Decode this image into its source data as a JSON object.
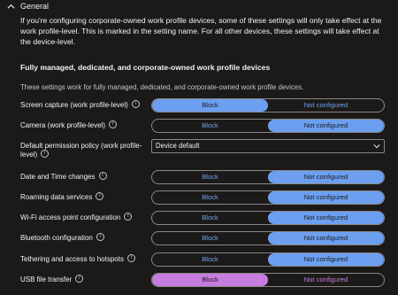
{
  "section": {
    "title": "General",
    "info": "If you're configuring corporate-owned work profile devices, some of these settings will only take effect at the work profile-level. This is marked in the setting name. For all other devices, these settings will take effect at the device-level.",
    "subheading": "Fully managed, dedicated, and corporate-owned work profile devices",
    "subdescription": "These settings work for fully managed, dedicated, and corporate-owned work profile devices."
  },
  "settings": [
    {
      "label": "Screen capture (work profile-level)",
      "type": "toggle",
      "left": "Block",
      "right": "Not configured",
      "selected": "Block",
      "accent": "#6c9ff0"
    },
    {
      "label": "Camera (work profile-level)",
      "type": "toggle",
      "left": "Block",
      "right": "Not configured",
      "selected": "Not configured",
      "accent": "#6c9ff0"
    },
    {
      "label": "Default permission policy (work profile-level)",
      "type": "dropdown",
      "value": "Device default"
    },
    {
      "label": "Date and Time changes",
      "type": "toggle",
      "left": "Block",
      "right": "Not configured",
      "selected": "Not configured",
      "accent": "#6c9ff0"
    },
    {
      "label": "Roaming data services",
      "type": "toggle",
      "left": "Block",
      "right": "Not configured",
      "selected": "Not configured",
      "accent": "#6c9ff0"
    },
    {
      "label": "Wi-Fi access point configuration",
      "type": "toggle",
      "left": "Block",
      "right": "Not configured",
      "selected": "Not configured",
      "accent": "#6c9ff0"
    },
    {
      "label": "Bluetooth configuration",
      "type": "toggle",
      "left": "Block",
      "right": "Not configured",
      "selected": "Not configured",
      "accent": "#6c9ff0"
    },
    {
      "label": "Tethering and access to hotspots",
      "type": "toggle",
      "left": "Block",
      "right": "Not configured",
      "selected": "Not configured",
      "accent": "#6c9ff0"
    },
    {
      "label": "USB file transfer",
      "type": "toggle",
      "left": "Block",
      "right": "Not configured",
      "selected": "Block",
      "accent": "#c77ce0"
    }
  ],
  "icons": {
    "collapse": "chevron-up-icon",
    "info": "info-icon",
    "dropdown": "chevron-down-icon"
  }
}
